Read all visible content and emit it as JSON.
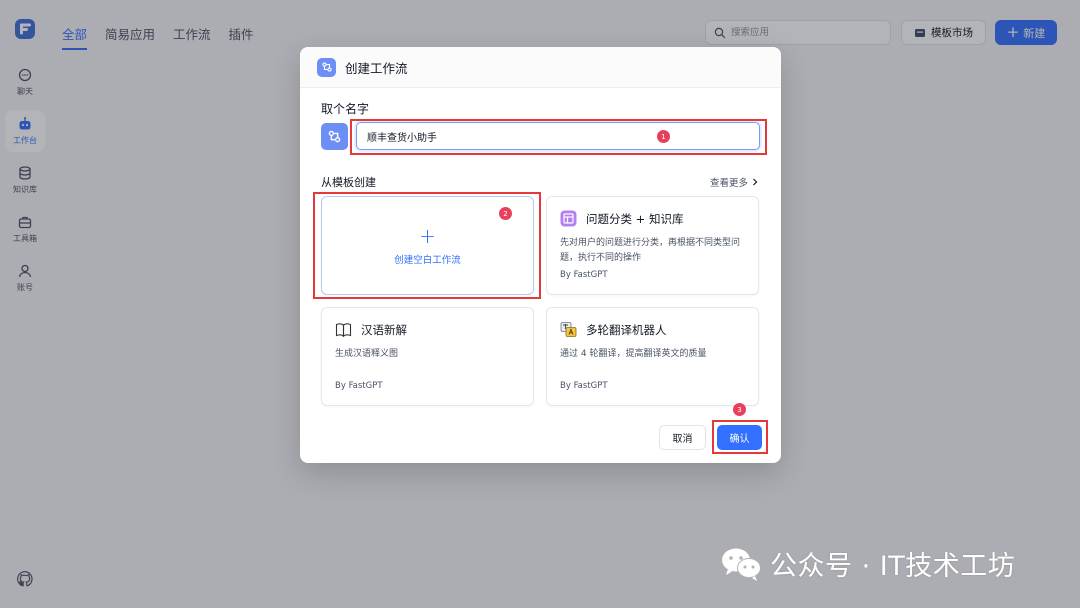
{
  "colors": {
    "accent": "#3370ff",
    "highlight": "#e5383b",
    "badge": "#e8405a"
  },
  "sidebar": {
    "items": [
      {
        "label": "聊天",
        "icon": "chat-icon"
      },
      {
        "label": "工作台",
        "icon": "robot-icon",
        "active": true
      },
      {
        "label": "知识库",
        "icon": "database-icon"
      },
      {
        "label": "工具箱",
        "icon": "toolbox-icon"
      },
      {
        "label": "账号",
        "icon": "user-icon"
      }
    ]
  },
  "header": {
    "tabs": [
      "全部",
      "简易应用",
      "工作流",
      "插件"
    ],
    "active_tab": "全部",
    "search_placeholder": "搜索应用",
    "market_label": "模板市场",
    "new_label": "新建"
  },
  "modal": {
    "title": "创建工作流",
    "name_label": "取个名字",
    "name_value": "顺丰查货小助手",
    "template_label": "从模板创建",
    "more_label": "查看更多",
    "blank_card_label": "创建空白工作流",
    "templates": [
      {
        "title": "问题分类 + 知识库",
        "desc": "先对用户的问题进行分类，再根据不同类型问题，执行不同的操作",
        "by": "By FastGPT",
        "icon": "layout-icon"
      },
      {
        "title": "汉语新解",
        "desc": "生成汉语释义图",
        "by": "By FastGPT",
        "icon": "book-icon"
      },
      {
        "title": "多轮翻译机器人",
        "desc": "通过 4 轮翻译，提高翻译英文的质量",
        "by": "By FastGPT",
        "icon": "translate-icon"
      }
    ],
    "cancel_label": "取消",
    "confirm_label": "确认"
  },
  "annotations": {
    "badge1": "1",
    "badge2": "2",
    "badge3": "3"
  },
  "watermark": {
    "text": "公众号 · IT技术工坊"
  }
}
